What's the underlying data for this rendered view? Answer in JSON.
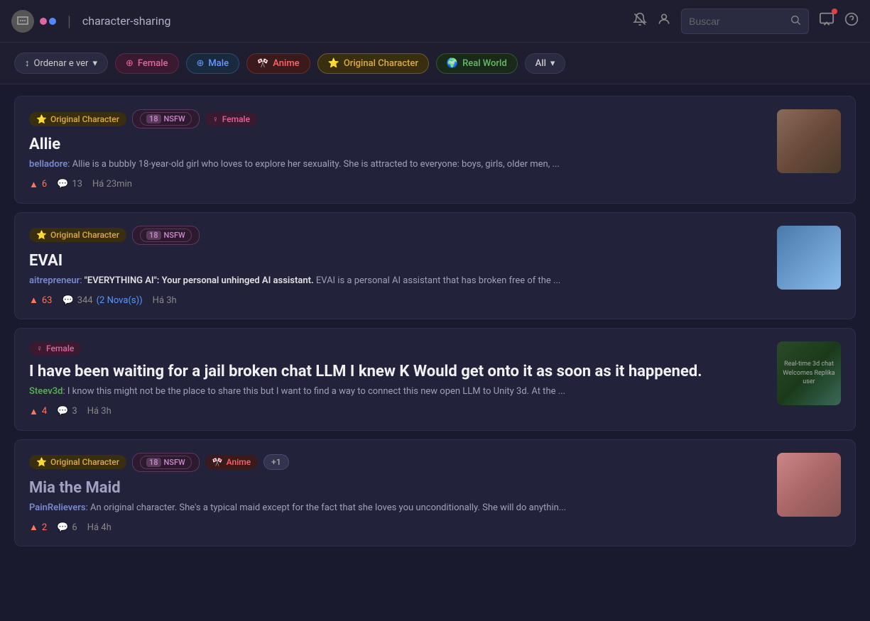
{
  "topnav": {
    "channel": "character-sharing",
    "search_placeholder": "Buscar",
    "actions": {
      "notification_icon": "🔔",
      "profile_icon": "👤",
      "screen_icon": "🖥",
      "help_icon": "?"
    }
  },
  "filterbar": {
    "sort_label": "Ordenar e ver",
    "chips": [
      {
        "id": "female",
        "label": "Female",
        "emoji": "♀"
      },
      {
        "id": "male",
        "label": "Male",
        "emoji": "♂"
      },
      {
        "id": "anime",
        "label": "Anime",
        "emoji": "🎌"
      },
      {
        "id": "oc",
        "label": "Original Character",
        "emoji": "⭐"
      },
      {
        "id": "rw",
        "label": "Real World",
        "emoji": "🌍"
      },
      {
        "id": "all",
        "label": "All",
        "emoji": ""
      }
    ]
  },
  "posts": [
    {
      "id": "allie",
      "tags": [
        {
          "type": "oc",
          "label": "Original Character",
          "emoji": "⭐"
        },
        {
          "type": "nsfw",
          "label": "NSFW",
          "num": "18"
        },
        {
          "type": "female",
          "label": "Female",
          "emoji": "♀"
        }
      ],
      "title": "Allie",
      "author": "belladore",
      "author_style": "blue",
      "desc": "Allie is a bubbly 18-year-old girl who loves to explore her sexuality. She is attracted to everyone: boys, girls, older men, ...",
      "upvotes": "6",
      "comments": "13",
      "time": "Há 23min",
      "image_class": "img-allie"
    },
    {
      "id": "evai",
      "tags": [
        {
          "type": "oc",
          "label": "Original Character",
          "emoji": "⭐"
        },
        {
          "type": "nsfw",
          "label": "NSFW",
          "num": "18"
        }
      ],
      "title": "EVAI",
      "author": "aitrepreneur",
      "author_style": "blue",
      "desc_prefix": "\"EVERYTHING AI\": Your personal unhinged AI assistant.",
      "desc_suffix": " EVAI is a personal AI assistant that has broken free of the ...",
      "upvotes": "63",
      "comments": "344",
      "new_label": "(2 Nova(s))",
      "time": "Há 3h",
      "image_class": "img-evai"
    },
    {
      "id": "jail",
      "tags": [
        {
          "type": "female",
          "label": "Female",
          "emoji": "♀"
        }
      ],
      "title": "I have been waiting for a jail broken chat LLM I knew K Would get onto it as soon as it happened.",
      "author": "Steev3d",
      "author_style": "green",
      "desc": "I know this might not be the place to share this but I want to find a way to connect this new open LLM to Unity 3d. At the ...",
      "upvotes": "4",
      "comments": "3",
      "time": "Há 3h",
      "image_class": "img-jail",
      "image_text": "Real-time 3d chat Welcomes Replika user"
    },
    {
      "id": "mia",
      "tags": [
        {
          "type": "oc",
          "label": "Original Character",
          "emoji": "⭐"
        },
        {
          "type": "nsfw",
          "label": "NSFW",
          "num": "18"
        },
        {
          "type": "anime",
          "label": "Anime",
          "emoji": "🎌"
        },
        {
          "type": "plus",
          "label": "+1"
        }
      ],
      "title": "Mia the Maid",
      "title_muted": true,
      "author": "PainRelievers",
      "author_style": "blue",
      "desc": "An original character. She's a typical maid except for the fact that she loves you unconditionally. She will do anythin...",
      "upvotes": "2",
      "comments": "6",
      "time": "Há 4h",
      "image_class": "img-mia"
    }
  ],
  "icons": {
    "sort": "↕",
    "chevron": "▾",
    "upvote": "▲",
    "comment": "💬",
    "search": "🔍",
    "bell": "🔕",
    "profile": "👤",
    "screen": "⬜",
    "help": "?"
  }
}
